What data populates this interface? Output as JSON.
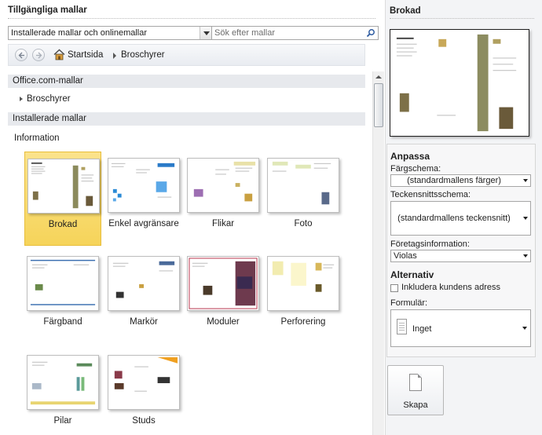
{
  "left": {
    "title": "Tillgängliga mallar",
    "source_select": "Installerade mallar och onlinemallar",
    "search_placeholder": "Sök efter mallar",
    "breadcrumb": {
      "home": "Startsida",
      "current": "Broschyrer"
    },
    "online_section": "Office.com-mallar",
    "online_item": "Broschyrer",
    "installed_section": "Installerade mallar",
    "group_label": "Information",
    "templates": [
      {
        "name": "Brokad",
        "selected": true
      },
      {
        "name": "Enkel avgränsare",
        "selected": false
      },
      {
        "name": "Flikar",
        "selected": false
      },
      {
        "name": "Foto",
        "selected": false
      },
      {
        "name": "Färgband",
        "selected": false
      },
      {
        "name": "Markör",
        "selected": false
      },
      {
        "name": "Moduler",
        "selected": false
      },
      {
        "name": "Perforering",
        "selected": false
      },
      {
        "name": "Pilar",
        "selected": false
      },
      {
        "name": "Studs",
        "selected": false
      }
    ]
  },
  "right": {
    "title": "Brokad",
    "customize_heading": "Anpassa",
    "color_scheme_label": "Färgschema:",
    "color_scheme_value": "(standardmallens färger)",
    "font_scheme_label": "Teckensnittsschema:",
    "font_scheme_value": "(standardmallens teckensnitt)",
    "business_info_label": "Företagsinformation:",
    "business_info_value": "Violas",
    "options_heading": "Alternativ",
    "include_address_label": "Inkludera kundens adress",
    "include_address_checked": false,
    "form_label": "Formulär:",
    "form_value": "Inget",
    "create_label": "Skapa"
  },
  "colors": {
    "selection": "#f8d868",
    "accent_green": "#8a8a4a",
    "section_bg": "#e7e9ed"
  }
}
